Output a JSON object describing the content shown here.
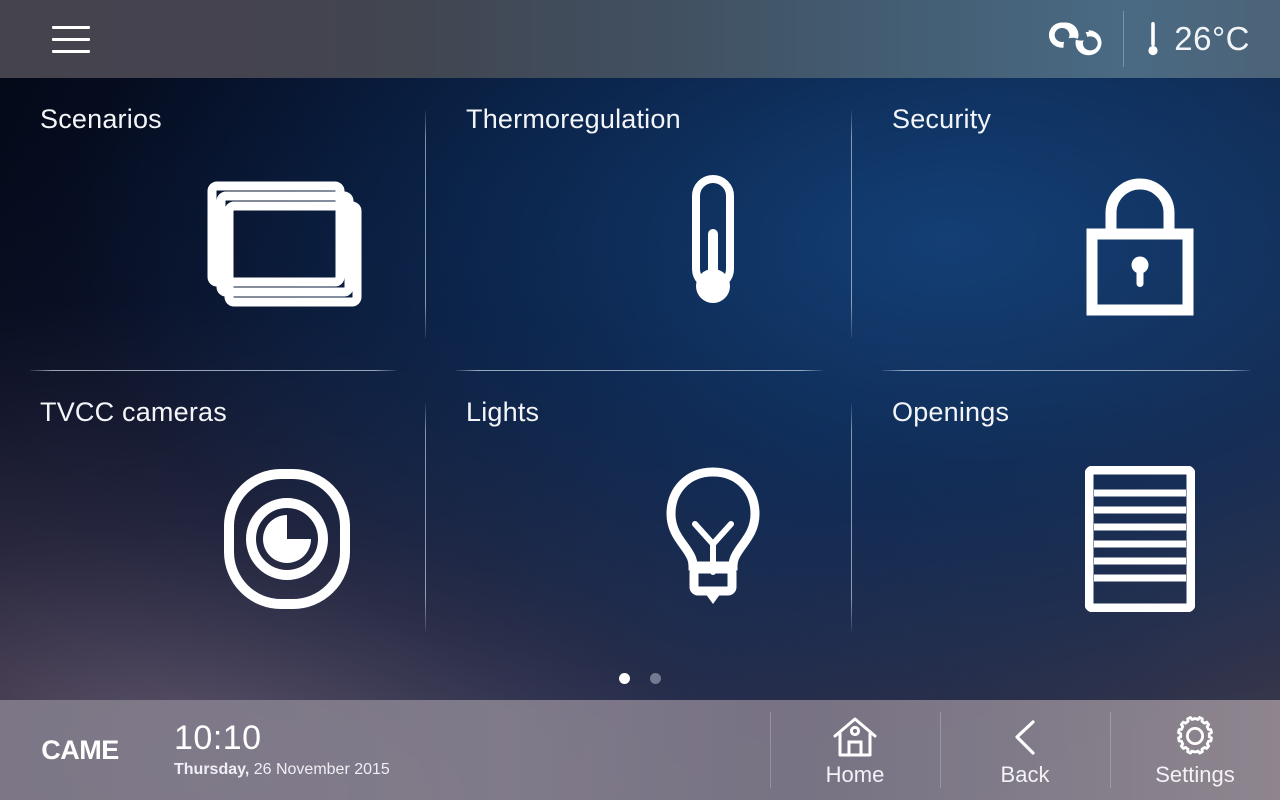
{
  "header": {
    "menu_icon": "hamburger-menu-icon",
    "weather_icon": "cloudy-weather-icon",
    "temperature_icon": "thermometer-icon",
    "temperature": "26°C"
  },
  "tiles": [
    {
      "label": "Scenarios",
      "icon": "scenarios-stack-icon"
    },
    {
      "label": "Thermoregulation",
      "icon": "thermometer-icon"
    },
    {
      "label": "Security",
      "icon": "padlock-icon"
    },
    {
      "label": "TVCC cameras",
      "icon": "camera-lens-icon"
    },
    {
      "label": "Lights",
      "icon": "lightbulb-icon"
    },
    {
      "label": "Openings",
      "icon": "blinds-shutter-icon"
    }
  ],
  "pagination": {
    "pages": 2,
    "active": 1
  },
  "footer": {
    "brand": "CAME",
    "time": "10:10",
    "date_weekday": "Thursday,",
    "date_rest": " 26 November 2015",
    "nav": [
      {
        "label": "Home",
        "icon": "home-icon"
      },
      {
        "label": "Back",
        "icon": "chevron-left-icon"
      },
      {
        "label": "Settings",
        "icon": "gear-icon"
      }
    ]
  },
  "colors": {
    "accent_white": "#ffffff",
    "topbar_left": "#45434e",
    "topbar_right": "#4c6378",
    "footer_bg": "#807a89",
    "tile_blue": "#0c2b55"
  }
}
